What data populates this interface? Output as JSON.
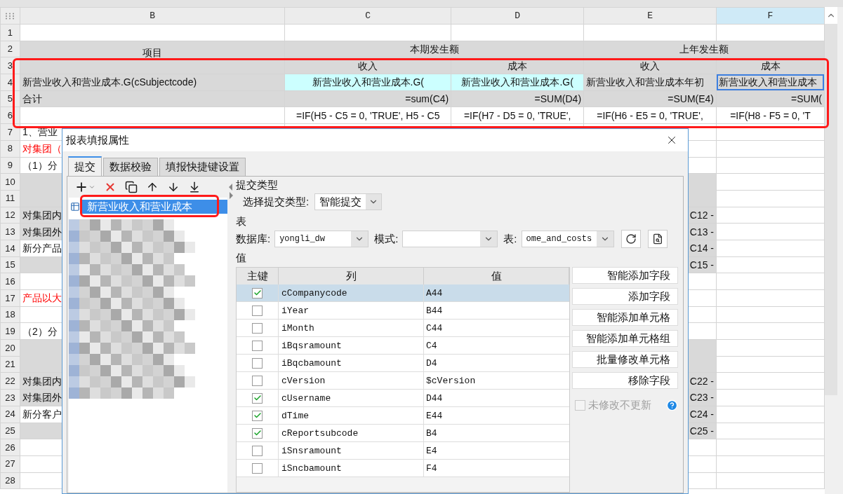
{
  "sheet": {
    "column_headers": [
      {
        "label": "B",
        "selected": false
      },
      {
        "label": "C",
        "selected": false
      },
      {
        "label": "D",
        "selected": false
      },
      {
        "label": "E",
        "selected": false
      },
      {
        "label": "F",
        "selected": true
      }
    ],
    "rows": [
      {
        "number": "1"
      },
      {
        "number": "2",
        "cells": [
          {
            "kind": "heading",
            "text": "项目",
            "rowspan": 2
          },
          {
            "kind": "heading",
            "text": "本期发生额",
            "colspan": 2
          },
          {
            "kind": "heading",
            "text": "上年发生额",
            "colspan": 2
          }
        ]
      },
      {
        "number": "3",
        "cells": [
          {
            "kind": "heading",
            "text": "收入"
          },
          {
            "kind": "heading",
            "text": "成本"
          },
          {
            "kind": "heading",
            "text": "收入"
          },
          {
            "kind": "heading",
            "text": "成本"
          }
        ]
      },
      {
        "number": "4",
        "cells": [
          {
            "kind": "label",
            "text": "新营业收入和营业成本.G(cSubjectcode)"
          },
          {
            "kind": "field",
            "text": "新营业收入和营业成本.G("
          },
          {
            "kind": "field",
            "text": "新营业收入和营业成本.G("
          },
          {
            "kind": "label",
            "text": "新营业收入和营业成本年初"
          },
          {
            "kind": "label",
            "text": "新营业收入和营业成本",
            "selected": true
          }
        ]
      },
      {
        "number": "5",
        "cells": [
          {
            "kind": "label",
            "text": "合计"
          },
          {
            "kind": "sum",
            "text": "=sum(C4)"
          },
          {
            "kind": "sum",
            "text": "=SUM(D4)"
          },
          {
            "kind": "sum",
            "text": "=SUM(E4)"
          },
          {
            "kind": "sum",
            "text": "=SUM("
          }
        ]
      },
      {
        "number": "6",
        "cells": [
          {
            "kind": "plain"
          },
          {
            "kind": "formula",
            "text": "=IF(H5 - C5 = 0, 'TRUE', H5 - C5"
          },
          {
            "kind": "formula",
            "text": "=IF(H7 - D5 = 0, 'TRUE',"
          },
          {
            "kind": "formula",
            "text": "=IF(H6 - E5 = 0, 'TRUE',"
          },
          {
            "kind": "formula",
            "text": "=IF(H8 - F5 = 0, 'T"
          }
        ]
      },
      {
        "number": "7",
        "cells": [
          {
            "kind": "plain",
            "text": "1、营业"
          },
          {
            "kind": "plain"
          },
          {
            "kind": "plain"
          },
          {
            "kind": "plain"
          },
          {
            "kind": "plain"
          }
        ]
      },
      {
        "number": "8",
        "cells": [
          {
            "kind": "warning",
            "text": "对集团（"
          },
          {
            "kind": "plain"
          },
          {
            "kind": "plain"
          },
          {
            "kind": "plain"
          },
          {
            "kind": "plain"
          }
        ]
      },
      {
        "number": "9",
        "cells": [
          {
            "kind": "plain",
            "text": "（1）分"
          },
          {
            "kind": "plain"
          },
          {
            "kind": "plain"
          },
          {
            "kind": "plain"
          },
          {
            "kind": "plain"
          }
        ]
      },
      {
        "number": "10",
        "cells": [
          {
            "kind": "gray",
            "rowspan": 2
          },
          {
            "kind": "plain"
          },
          {
            "kind": "plain"
          },
          {
            "kind": "gray",
            "rowspan": 2
          },
          {
            "kind": "plain"
          }
        ]
      },
      {
        "number": "11",
        "cells": [
          {
            "kind": "plain"
          },
          {
            "kind": "plain"
          },
          {
            "kind": "plain"
          }
        ]
      },
      {
        "number": "12",
        "cells": [
          {
            "kind": "label",
            "text": "对集团内"
          },
          {
            "kind": "plain"
          },
          {
            "kind": "plain"
          },
          {
            "kind": "sum",
            "text": "C12 -"
          },
          {
            "kind": "plain"
          }
        ]
      },
      {
        "number": "13",
        "cells": [
          {
            "kind": "label",
            "text": "对集团外"
          },
          {
            "kind": "plain"
          },
          {
            "kind": "plain"
          },
          {
            "kind": "sum",
            "text": "C13 -"
          },
          {
            "kind": "plain"
          }
        ]
      },
      {
        "number": "14",
        "cells": [
          {
            "kind": "plain",
            "text": "新分产品"
          },
          {
            "kind": "plain"
          },
          {
            "kind": "plain"
          },
          {
            "kind": "sum",
            "text": "C14 -"
          },
          {
            "kind": "plain"
          }
        ]
      },
      {
        "number": "15",
        "cells": [
          {
            "kind": "gray"
          },
          {
            "kind": "plain"
          },
          {
            "kind": "plain"
          },
          {
            "kind": "sum",
            "text": "C15 -"
          },
          {
            "kind": "plain"
          }
        ]
      },
      {
        "number": "16"
      },
      {
        "number": "17",
        "cells": [
          {
            "kind": "warning",
            "text": "产品以大"
          },
          {
            "kind": "plain"
          },
          {
            "kind": "plain"
          },
          {
            "kind": "plain"
          },
          {
            "kind": "plain"
          }
        ]
      },
      {
        "number": "18"
      },
      {
        "number": "19",
        "cells": [
          {
            "kind": "plain",
            "text": "（2）分"
          },
          {
            "kind": "plain"
          },
          {
            "kind": "plain"
          },
          {
            "kind": "plain"
          },
          {
            "kind": "plain"
          }
        ]
      },
      {
        "number": "20",
        "cells": [
          {
            "kind": "gray",
            "rowspan": 2
          },
          {
            "kind": "plain"
          },
          {
            "kind": "plain"
          },
          {
            "kind": "gray",
            "rowspan": 2
          },
          {
            "kind": "plain"
          }
        ]
      },
      {
        "number": "21",
        "cells": [
          {
            "kind": "plain"
          },
          {
            "kind": "plain"
          },
          {
            "kind": "plain"
          }
        ]
      },
      {
        "number": "22",
        "cells": [
          {
            "kind": "label",
            "text": "对集团内"
          },
          {
            "kind": "plain"
          },
          {
            "kind": "plain"
          },
          {
            "kind": "sum",
            "text": "C22 -"
          },
          {
            "kind": "plain"
          }
        ]
      },
      {
        "number": "23",
        "cells": [
          {
            "kind": "label",
            "text": "对集团外"
          },
          {
            "kind": "plain"
          },
          {
            "kind": "plain"
          },
          {
            "kind": "sum",
            "text": "C23 -"
          },
          {
            "kind": "plain"
          }
        ]
      },
      {
        "number": "24",
        "cells": [
          {
            "kind": "plain",
            "text": "新分客户"
          },
          {
            "kind": "plain"
          },
          {
            "kind": "plain"
          },
          {
            "kind": "sum",
            "text": "C24 -"
          },
          {
            "kind": "plain"
          }
        ]
      },
      {
        "number": "25",
        "cells": [
          {
            "kind": "gray"
          },
          {
            "kind": "plain"
          },
          {
            "kind": "plain"
          },
          {
            "kind": "sum",
            "text": "C25 -"
          },
          {
            "kind": "plain"
          }
        ]
      },
      {
        "number": "26"
      },
      {
        "number": "27"
      },
      {
        "number": "28"
      }
    ]
  },
  "dialog": {
    "title": "报表填报属性",
    "tabs": [
      {
        "label": "提交",
        "selected": true
      },
      {
        "label": "数据校验",
        "selected": false
      },
      {
        "label": "填报快捷键设置",
        "selected": false
      }
    ],
    "rule_list": {
      "items": [
        {
          "label": "新营业收入和营业成本",
          "selected": true
        }
      ]
    },
    "submit_type": {
      "group": "提交类型",
      "label": "选择提交类型:",
      "value": "智能提交"
    },
    "table_group": {
      "group": "表",
      "database_label": "数据库:",
      "database": "yongli_dw",
      "schema_label": "模式:",
      "table_label": "表:",
      "table": "ome_and_costs"
    },
    "values": {
      "group": "值",
      "columns": [
        "主键",
        "列",
        "值"
      ],
      "rows": [
        {
          "key": true,
          "column": "cCompanycode",
          "value": "A44",
          "selected": true
        },
        {
          "key": false,
          "column": "iYear",
          "value": "B44",
          "selected": false
        },
        {
          "key": false,
          "column": "iMonth",
          "value": "C44",
          "selected": false
        },
        {
          "key": false,
          "column": "iBqsramount",
          "value": "C4",
          "selected": false
        },
        {
          "key": false,
          "column": "iBqcbamount",
          "value": "D4",
          "selected": false
        },
        {
          "key": false,
          "column": "cVersion",
          "value": "$cVersion",
          "selected": false
        },
        {
          "key": true,
          "column": "cUsername",
          "value": "D44",
          "selected": false
        },
        {
          "key": true,
          "column": "dTime",
          "value": "E44",
          "selected": false
        },
        {
          "key": true,
          "column": "cReportsubcode",
          "value": "B4",
          "selected": false
        },
        {
          "key": false,
          "column": "iSnsramount",
          "value": "E4",
          "selected": false
        },
        {
          "key": false,
          "column": "iSncbamount",
          "value": "F4",
          "selected": false
        }
      ]
    },
    "buttons": [
      "智能添加字段",
      "添加字段",
      "智能添加单元格",
      "智能添加单元格组",
      "批量修改单元格",
      "移除字段"
    ],
    "skip_unchanged": {
      "label": "未修改不更新",
      "checked": false,
      "disabled": true
    }
  }
}
